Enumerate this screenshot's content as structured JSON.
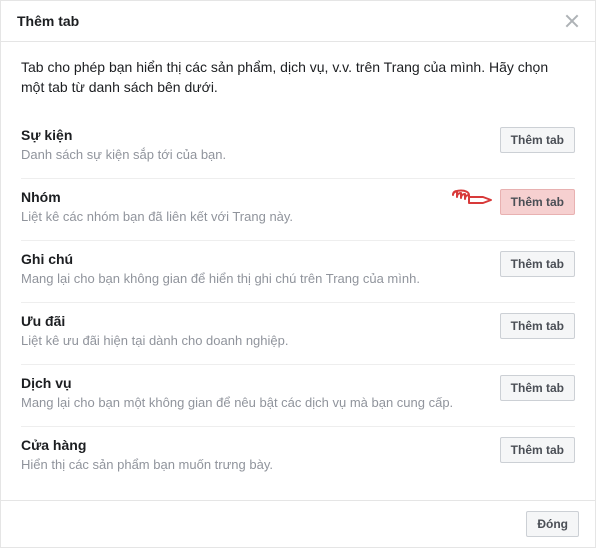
{
  "modal": {
    "title": "Thêm tab",
    "intro": "Tab cho phép bạn hiển thị các sản phẩm, dịch vụ, v.v. trên Trang của mình. Hãy chọn một tab từ danh sách bên dưới.",
    "close_button_label": "Đóng"
  },
  "add_button_label": "Thêm tab",
  "tabs": [
    {
      "title": "Sự kiện",
      "desc": "Danh sách sự kiện sắp tới của bạn."
    },
    {
      "title": "Nhóm",
      "desc": "Liệt kê các nhóm bạn đã liên kết với Trang này."
    },
    {
      "title": "Ghi chú",
      "desc": "Mang lại cho bạn không gian để hiển thị ghi chú trên Trang của mình."
    },
    {
      "title": "Ưu đãi",
      "desc": "Liệt kê ưu đãi hiện tại dành cho doanh nghiệp."
    },
    {
      "title": "Dịch vụ",
      "desc": "Mang lại cho bạn một không gian để nêu bật các dịch vụ mà bạn cung cấp."
    },
    {
      "title": "Cửa hàng",
      "desc": "Hiển thị các sản phẩm bạn muốn trưng bày."
    }
  ]
}
